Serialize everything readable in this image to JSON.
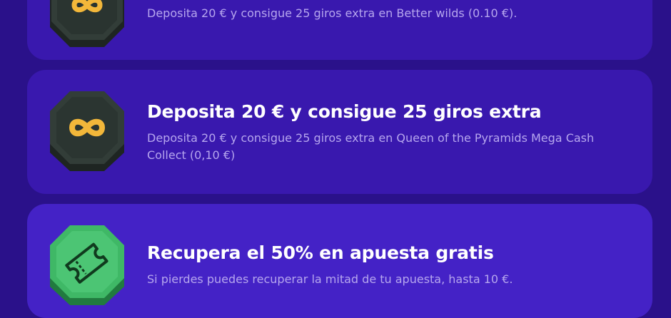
{
  "offers": [
    {
      "icon": "infinity-icon",
      "description": "Deposita 20 € y consigue 25 giros extra en Better wilds (0.10 €)."
    },
    {
      "icon": "infinity-icon",
      "title": "Deposita 20 € y consigue 25 giros extra",
      "description": "Deposita 20 € y consigue 25 giros extra en Queen of the Pyramids Mega Cash Collect (0,10 €)"
    },
    {
      "icon": "ticket-icon",
      "title": "Recupera el 50% en apuesta gratis",
      "description": "Si pierdes puedes recuperar la mitad de tu apuesta, hasta 10 €."
    }
  ],
  "colors": {
    "background": "#2a118a",
    "card": "#3918ae",
    "card_highlight": "#4422c6",
    "title_text": "#ffffff",
    "description_text": "#b6a6ee",
    "coin_dark": "#2f3a35",
    "coin_gold": "#f2b73a",
    "coin_green": "#3fb866"
  }
}
